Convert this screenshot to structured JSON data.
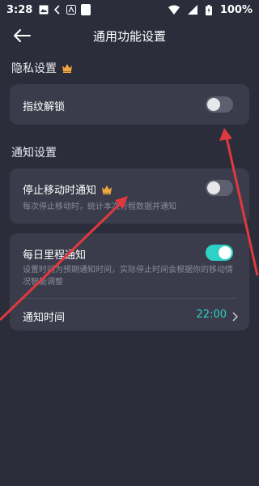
{
  "status_bar": {
    "time": "3:28",
    "battery_text": "100%"
  },
  "header": {
    "title": "通用功能设置"
  },
  "privacy": {
    "section_title": "隐私设置",
    "fingerprint_label": "指纹解锁",
    "fingerprint_on": false
  },
  "notify": {
    "section_title": "通知设置",
    "stop_label": "停止移动时通知",
    "stop_sub": "每次停止移动时，统计本次行程数据并通知",
    "stop_on": false,
    "daily_label": "每日里程通知",
    "daily_sub": "设置时间为预期通知时间，实际停止时间会根据你的移动情况智能调整",
    "daily_on": true,
    "time_label": "通知时间",
    "time_value": "22:00"
  },
  "colors": {
    "accent": "#2ed1c5",
    "crown": "#f0a63c",
    "arrow": "#e0393e"
  }
}
